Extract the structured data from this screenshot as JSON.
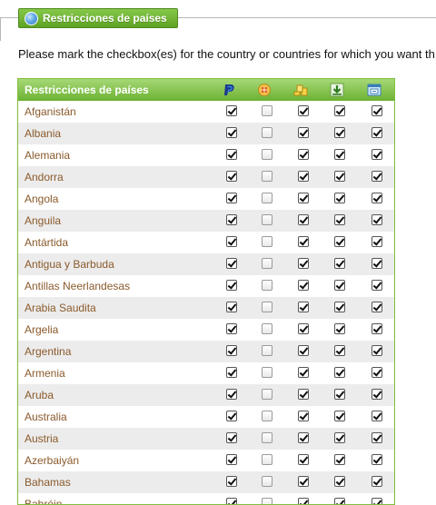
{
  "section": {
    "title": "Restricciones de países"
  },
  "instructions": "Please mark the checkbox(es) for the country or countries for which you want th",
  "table": {
    "header_title": "Restricciones de países",
    "column_icons": [
      "paypal-icon",
      "gift-voucher-icon",
      "coins-icon",
      "download-icon",
      "bank-transfer-icon"
    ],
    "rows": [
      {
        "country": "Afganistán",
        "checks": [
          true,
          false,
          true,
          true,
          true
        ]
      },
      {
        "country": "Albania",
        "checks": [
          true,
          false,
          true,
          true,
          true
        ]
      },
      {
        "country": "Alemania",
        "checks": [
          true,
          false,
          true,
          true,
          true
        ]
      },
      {
        "country": "Andorra",
        "checks": [
          true,
          false,
          true,
          true,
          true
        ]
      },
      {
        "country": "Angola",
        "checks": [
          true,
          false,
          true,
          true,
          true
        ]
      },
      {
        "country": "Anguila",
        "checks": [
          true,
          false,
          true,
          true,
          true
        ]
      },
      {
        "country": "Antártida",
        "checks": [
          true,
          false,
          true,
          true,
          true
        ]
      },
      {
        "country": "Antigua y Barbuda",
        "checks": [
          true,
          false,
          true,
          true,
          true
        ]
      },
      {
        "country": "Antillas Neerlandesas",
        "checks": [
          true,
          false,
          true,
          true,
          true
        ]
      },
      {
        "country": "Arabia Saudita",
        "checks": [
          true,
          false,
          true,
          true,
          true
        ]
      },
      {
        "country": "Argelia",
        "checks": [
          true,
          false,
          true,
          true,
          true
        ]
      },
      {
        "country": "Argentina",
        "checks": [
          true,
          false,
          true,
          true,
          true
        ]
      },
      {
        "country": "Armenia",
        "checks": [
          true,
          false,
          true,
          true,
          true
        ]
      },
      {
        "country": "Aruba",
        "checks": [
          true,
          false,
          true,
          true,
          true
        ]
      },
      {
        "country": "Australia",
        "checks": [
          true,
          false,
          true,
          true,
          true
        ]
      },
      {
        "country": "Austria",
        "checks": [
          true,
          false,
          true,
          true,
          true
        ]
      },
      {
        "country": "Azerbaiyán",
        "checks": [
          true,
          false,
          true,
          true,
          true
        ]
      },
      {
        "country": "Bahamas",
        "checks": [
          true,
          false,
          true,
          true,
          true
        ]
      },
      {
        "country": "Bahréin",
        "checks": [
          true,
          false,
          true,
          true,
          true
        ]
      }
    ]
  }
}
